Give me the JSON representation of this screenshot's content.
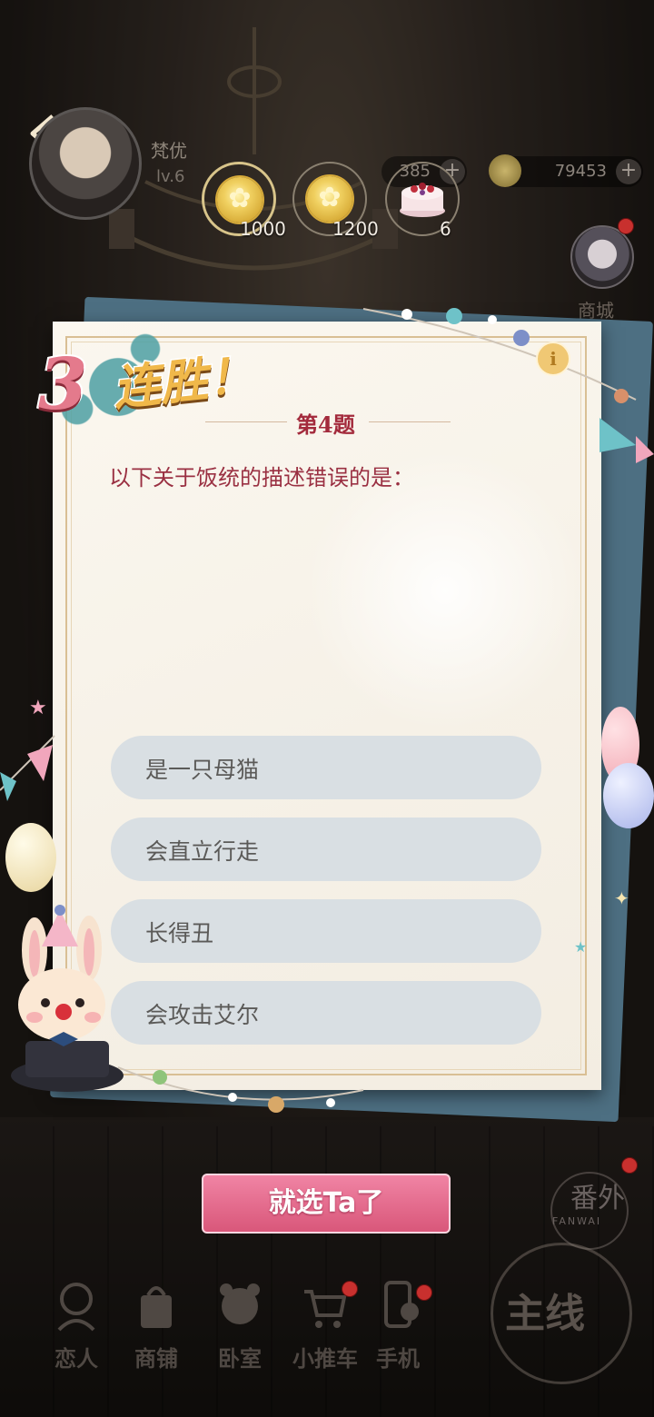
{
  "player": {
    "name": "梵优",
    "level": "lv.6"
  },
  "currency": {
    "gems": "385",
    "coins": "79453",
    "plus": "+"
  },
  "rewards": [
    {
      "icon": "coin-icon",
      "count": "1000"
    },
    {
      "icon": "coin-icon",
      "count": "1200"
    },
    {
      "icon": "cake-icon",
      "count": "6"
    }
  ],
  "side": {
    "shop_label": "商城"
  },
  "quiz": {
    "streak_number": "3",
    "streak_text": "连胜！",
    "question_number": "第4题",
    "question": "以下关于饭统的描述错误的是：",
    "info_label": "i",
    "options": [
      {
        "label": "是一只母猫"
      },
      {
        "label": "会直立行走"
      },
      {
        "label": "长得丑"
      },
      {
        "label": "会攻击艾尔"
      }
    ],
    "confirm_label": "就选Ta了"
  },
  "extra": {
    "fanwai_cn": "番外",
    "fanwai_en": "FANWAI",
    "mainline": "主线"
  },
  "nav": [
    {
      "label": "恋人",
      "icon": "lover-icon"
    },
    {
      "label": "商铺",
      "icon": "shop-bag-icon"
    },
    {
      "label": "卧室",
      "icon": "bedroom-icon"
    },
    {
      "label": "小推车",
      "icon": "cart-icon"
    },
    {
      "label": "手机",
      "icon": "phone-icon"
    }
  ],
  "colors": {
    "accent": "#d9577a",
    "question": "#9a3042",
    "option_bg": "#d9dfe3"
  }
}
